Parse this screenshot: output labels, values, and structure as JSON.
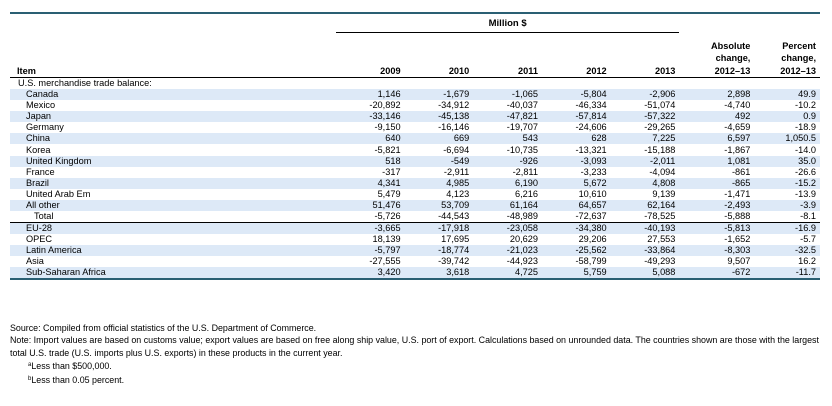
{
  "table": {
    "header": {
      "group_label": "Million $",
      "item_label": "Item",
      "years": [
        "2009",
        "2010",
        "2011",
        "2012",
        "2013"
      ],
      "abs_change": [
        "Absolute",
        "change,",
        "2012–13"
      ],
      "pct_change": [
        "Percent",
        "change,",
        "2012–13"
      ]
    },
    "section_label": "U.S. merchandise trade balance:",
    "rows": [
      {
        "label": "Canada",
        "level": 1,
        "values": [
          "1,146",
          "-1,679",
          "-1,065",
          "-5,804",
          "-2,906",
          "2,898",
          "49.9"
        ]
      },
      {
        "label": "Mexico",
        "level": 1,
        "values": [
          "-20,892",
          "-34,912",
          "-40,037",
          "-46,334",
          "-51,074",
          "-4,740",
          "-10.2"
        ]
      },
      {
        "label": "Japan",
        "level": 1,
        "values": [
          "-33,146",
          "-45,138",
          "-47,821",
          "-57,814",
          "-57,322",
          "492",
          "0.9"
        ]
      },
      {
        "label": "Germany",
        "level": 1,
        "values": [
          "-9,150",
          "-16,146",
          "-19,707",
          "-24,606",
          "-29,265",
          "-4,659",
          "-18.9"
        ]
      },
      {
        "label": "China",
        "level": 1,
        "values": [
          "640",
          "669",
          "543",
          "628",
          "7,225",
          "6,597",
          "1,050.5"
        ]
      },
      {
        "label": "Korea",
        "level": 1,
        "values": [
          "-5,821",
          "-6,694",
          "-10,735",
          "-13,321",
          "-15,188",
          "-1,867",
          "-14.0"
        ]
      },
      {
        "label": "United Kingdom",
        "level": 1,
        "values": [
          "518",
          "-549",
          "-926",
          "-3,093",
          "-2,011",
          "1,081",
          "35.0"
        ]
      },
      {
        "label": "France",
        "level": 1,
        "values": [
          "-317",
          "-2,911",
          "-2,811",
          "-3,233",
          "-4,094",
          "-861",
          "-26.6"
        ]
      },
      {
        "label": "Brazil",
        "level": 1,
        "values": [
          "4,341",
          "4,985",
          "6,190",
          "5,672",
          "4,808",
          "-865",
          "-15.2"
        ]
      },
      {
        "label": "United Arab Em",
        "level": 1,
        "values": [
          "5,479",
          "4,123",
          "6,216",
          "10,610",
          "9,139",
          "-1,471",
          "-13.9"
        ]
      },
      {
        "label": "All other",
        "level": 1,
        "values": [
          "51,476",
          "53,709",
          "61,164",
          "64,657",
          "62,164",
          "-2,493",
          "-3.9"
        ]
      },
      {
        "label": "Total",
        "level": 2,
        "values": [
          "-5,726",
          "-44,543",
          "-48,989",
          "-72,637",
          "-78,525",
          "-5,888",
          "-8.1"
        ]
      },
      {
        "label": "EU-28",
        "level": 1,
        "group_start": true,
        "values": [
          "-3,665",
          "-17,918",
          "-23,058",
          "-34,380",
          "-40,193",
          "-5,813",
          "-16.9"
        ]
      },
      {
        "label": "OPEC",
        "level": 1,
        "values": [
          "18,139",
          "17,695",
          "20,629",
          "29,206",
          "27,553",
          "-1,652",
          "-5.7"
        ]
      },
      {
        "label": "Latin America",
        "level": 1,
        "values": [
          "-5,797",
          "-18,774",
          "-21,023",
          "-25,562",
          "-33,864",
          "-8,303",
          "-32.5"
        ]
      },
      {
        "label": "Asia",
        "level": 1,
        "values": [
          "-27,555",
          "-39,742",
          "-44,923",
          "-58,799",
          "-49,293",
          "9,507",
          "16.2"
        ]
      },
      {
        "label": "Sub-Saharan Africa",
        "level": 1,
        "values": [
          "3,420",
          "3,618",
          "4,725",
          "5,759",
          "5,088",
          "-672",
          "-11.7"
        ]
      }
    ]
  },
  "notes": {
    "source": "Source: Compiled from official statistics of the U.S. Department of Commerce.",
    "note": "Note: Import values are based on customs value; export values are based on free along ship value, U.S. port of export. Calculations based on unrounded data. The countries shown are those with the largest total U.S. trade (U.S. imports plus U.S. exports) in these products in the current year.",
    "footnotes": [
      {
        "mark": "a",
        "text": "Less than $500,000."
      },
      {
        "mark": "b",
        "text": "Less than 0.05 percent."
      }
    ]
  }
}
